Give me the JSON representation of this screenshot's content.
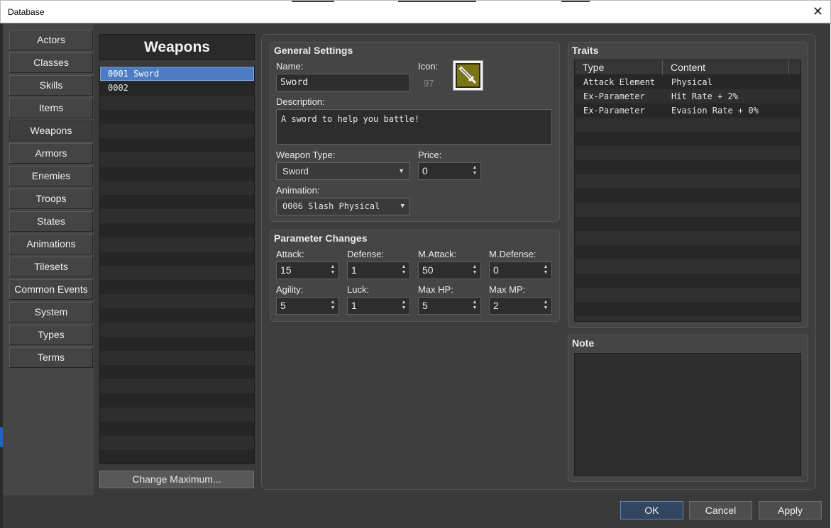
{
  "window": {
    "title": "Database",
    "close_glyph": "✕"
  },
  "nav": {
    "items": [
      "Actors",
      "Classes",
      "Skills",
      "Items",
      "Weapons",
      "Armors",
      "Enemies",
      "Troops",
      "States",
      "Animations",
      "Tilesets",
      "Common Events",
      "System",
      "Types",
      "Terms"
    ],
    "active": "Weapons"
  },
  "list": {
    "title": "Weapons",
    "items": [
      "0001 Sword",
      "0002"
    ],
    "selected_index": 0,
    "change_max_label": "Change Maximum..."
  },
  "general": {
    "title": "General Settings",
    "name_label": "Name:",
    "name_value": "Sword",
    "icon_label": "Icon:",
    "icon_index": "97",
    "icon_name": "sword-icon",
    "description_label": "Description:",
    "description_value": "A sword to help you battle!",
    "weapon_type_label": "Weapon Type:",
    "weapon_type_value": "Sword",
    "price_label": "Price:",
    "price_value": "0",
    "animation_label": "Animation:",
    "animation_value": "0006 Slash Physical"
  },
  "params": {
    "title": "Parameter Changes",
    "attack_label": "Attack:",
    "attack_value": "15",
    "defense_label": "Defense:",
    "defense_value": "1",
    "mattack_label": "M.Attack:",
    "mattack_value": "50",
    "mdefense_label": "M.Defense:",
    "mdefense_value": "0",
    "agility_label": "Agility:",
    "agility_value": "5",
    "luck_label": "Luck:",
    "luck_value": "1",
    "maxhp_label": "Max HP:",
    "maxhp_value": "5",
    "maxmp_label": "Max MP:",
    "maxmp_value": "2"
  },
  "traits": {
    "title": "Traits",
    "col_type": "Type",
    "col_content": "Content",
    "rows": [
      {
        "type": "Attack Element",
        "content": "Physical"
      },
      {
        "type": "Ex-Parameter",
        "content": "Hit Rate + 2%"
      },
      {
        "type": "Ex-Parameter",
        "content": "Evasion Rate + 0%"
      }
    ]
  },
  "note": {
    "title": "Note",
    "value": ""
  },
  "footer": {
    "ok": "OK",
    "cancel": "Cancel",
    "apply": "Apply"
  },
  "colors": {
    "accent": "#4d7cc3",
    "panel": "#454545",
    "icon_bg": "#7a7416"
  }
}
